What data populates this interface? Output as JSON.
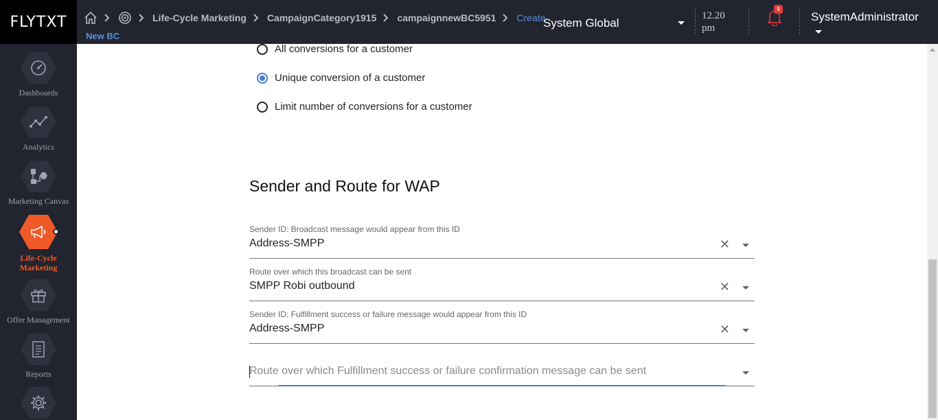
{
  "brand": {
    "logo_text": "FLYTXT"
  },
  "breadcrumb": {
    "items": [
      "Life-Cycle Marketing",
      "CampaignCategory1915",
      "campaignnewBC5951"
    ],
    "current": "Create",
    "sub": "New BC"
  },
  "header": {
    "region": "System Global",
    "time_line1": "12.20",
    "time_line2": "pm",
    "notification_count": "9",
    "user": "SystemAdministrator"
  },
  "sidebar": {
    "items": [
      {
        "label": "Dashboards",
        "icon": "gauge-icon"
      },
      {
        "label": "Analytics",
        "icon": "line-chart-icon"
      },
      {
        "label": "Marketing Canvas",
        "icon": "flow-diagram-icon"
      },
      {
        "label": "Life-Cycle Marketing",
        "icon": "megaphone-icon",
        "active": true
      },
      {
        "label": "Offer Management",
        "icon": "gift-icon"
      },
      {
        "label": "Reports",
        "icon": "report-icon"
      },
      {
        "label": "",
        "icon": "gear-icon"
      }
    ]
  },
  "conversion": {
    "options": [
      {
        "label": "All conversions for a customer",
        "checked": false
      },
      {
        "label": "Unique conversion of a customer",
        "checked": true
      },
      {
        "label": "Limit number of conversions for a customer",
        "checked": false
      }
    ]
  },
  "sender_route": {
    "title": "Sender and Route for WAP",
    "fields": [
      {
        "label": "Sender ID: Broadcast message would appear from this ID",
        "value": "Address-SMPP"
      },
      {
        "label": "Route over which this broadcast can be sent",
        "value": "SMPP Robi outbound"
      },
      {
        "label": "Sender ID: Fulfillment success or failure message would appear from this ID",
        "value": "Address-SMPP"
      }
    ],
    "empty_field_placeholder": "Route over which Fulfillment success or failure confirmation message can be sent"
  },
  "colors": {
    "accent": "#f05a28",
    "link": "#5b8fd6",
    "topbar": "#22242f",
    "focus": "#4a7fcb"
  }
}
